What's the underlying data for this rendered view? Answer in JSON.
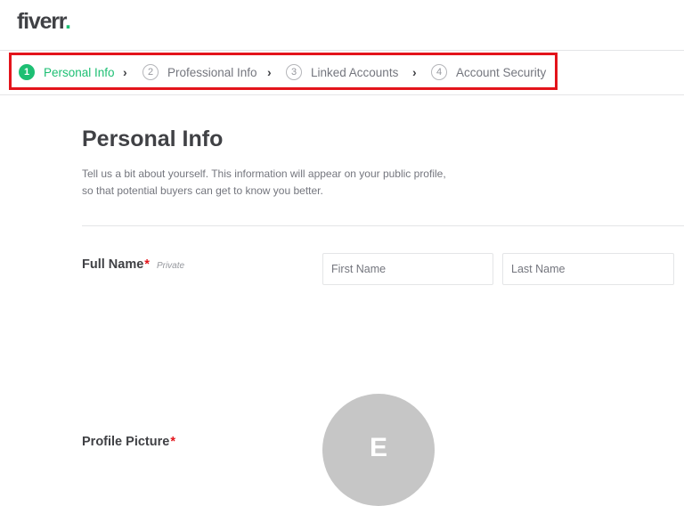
{
  "header": {
    "logo_text": "fiverr",
    "logo_dot": ".",
    "brand_color": "#1dbf73"
  },
  "steps": [
    {
      "number": "1",
      "label": "Personal Info",
      "state": "active"
    },
    {
      "number": "2",
      "label": "Professional Info",
      "state": "inactive"
    },
    {
      "number": "3",
      "label": "Linked Accounts",
      "state": "inactive"
    },
    {
      "number": "4",
      "label": "Account Security",
      "state": "inactive"
    }
  ],
  "step_separator_icon": "chevron-right-icon",
  "step_separator_glyph": "›",
  "highlight_color": "#e3141b",
  "main": {
    "title": "Personal Info",
    "description": "Tell us a bit about yourself. This information will appear on your public profile, so that potential buyers can get to know you better."
  },
  "form": {
    "full_name": {
      "label": "Full Name",
      "required_mark": "*",
      "privacy_tag": "Private",
      "first_name_placeholder": "First Name",
      "first_name_value": "",
      "last_name_placeholder": "Last Name",
      "last_name_value": ""
    },
    "profile_picture": {
      "label": "Profile Picture",
      "required_mark": "*",
      "avatar_initial": "E"
    }
  }
}
